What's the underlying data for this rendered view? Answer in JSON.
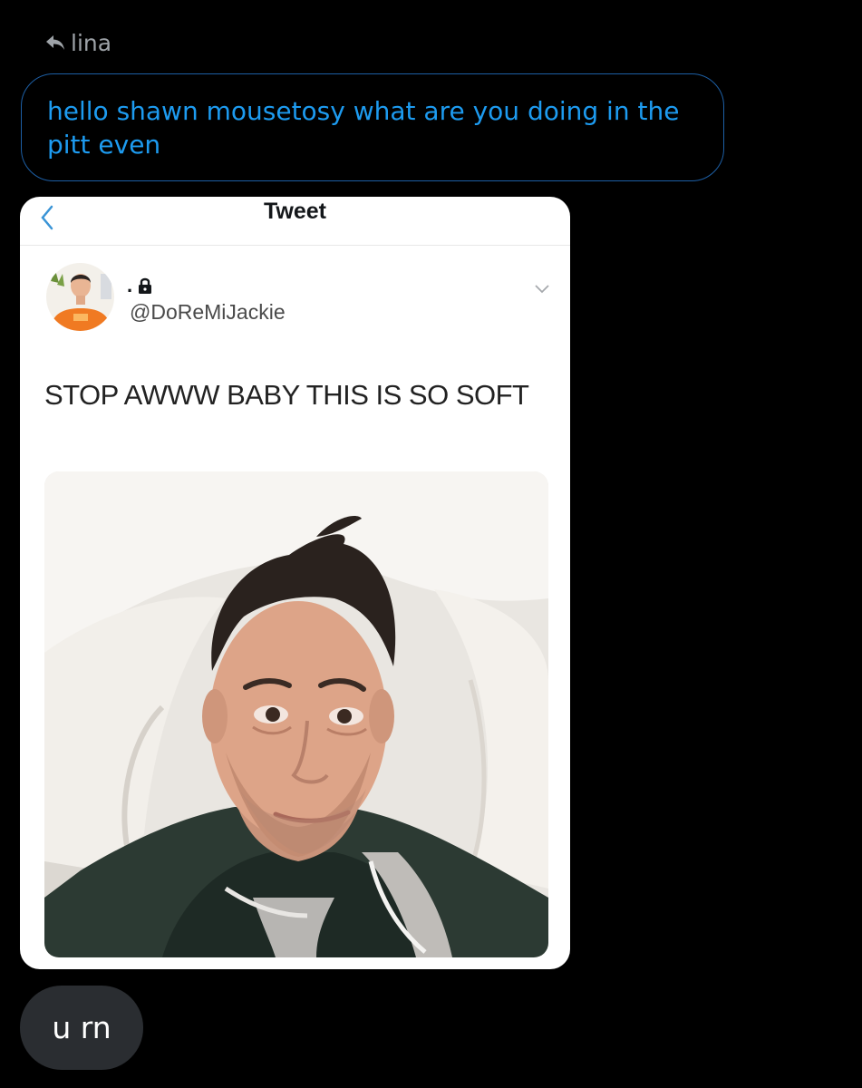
{
  "reply_to": {
    "icon": "reply-arrow-icon",
    "name": "lina"
  },
  "messages": {
    "quoted": "hello shawn mousetosy what are you doing in the pitt even",
    "reply": "u rn"
  },
  "tweet_card": {
    "header_title": "Tweet",
    "display_name": ".",
    "lock_icon": "lock-icon",
    "handle": "@DoReMiJackie",
    "text": "STOP AWWW BABY THIS IS SO SOFT"
  },
  "colors": {
    "background": "#000000",
    "accent_blue": "#1d9bf0",
    "bubble_border": "#1d5fa5",
    "incoming_bubble": "#2a2d31"
  }
}
